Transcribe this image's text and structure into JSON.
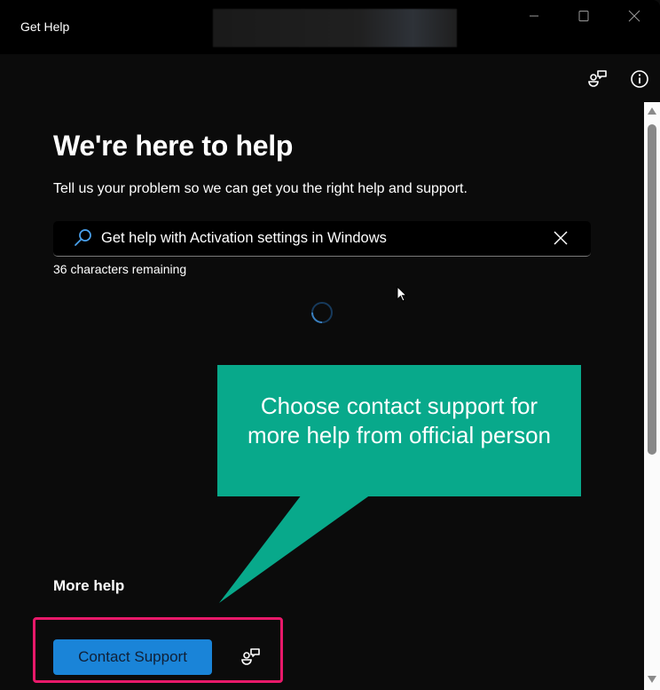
{
  "window": {
    "title": "Get Help",
    "controls": {
      "minimize": "minimize-icon",
      "maximize": "maximize-icon",
      "close": "close-icon"
    }
  },
  "toolbar": {
    "contact_icon": "contact-support-icon",
    "info_icon": "info-icon"
  },
  "main": {
    "heading": "We're here to help",
    "subheading": "Tell us your problem so we can get you the right help and support.",
    "search": {
      "value": "Get help with Activation settings in Windows",
      "icon": "search-icon",
      "clear_icon": "clear-icon"
    },
    "char_remaining": "36 characters remaining",
    "loading": true
  },
  "annotation": {
    "callout_text_line1": "Choose contact support for",
    "callout_text_line2": "more help from official person",
    "callout_color": "#08a98b",
    "highlight_color": "#e8196a"
  },
  "more_help": {
    "heading": "More help",
    "contact_button_label": "Contact Support",
    "contact_icon": "contact-support-icon"
  },
  "colors": {
    "accent": "#1a84d8",
    "background": "#0b0b0b",
    "titlebar": "#000000"
  }
}
